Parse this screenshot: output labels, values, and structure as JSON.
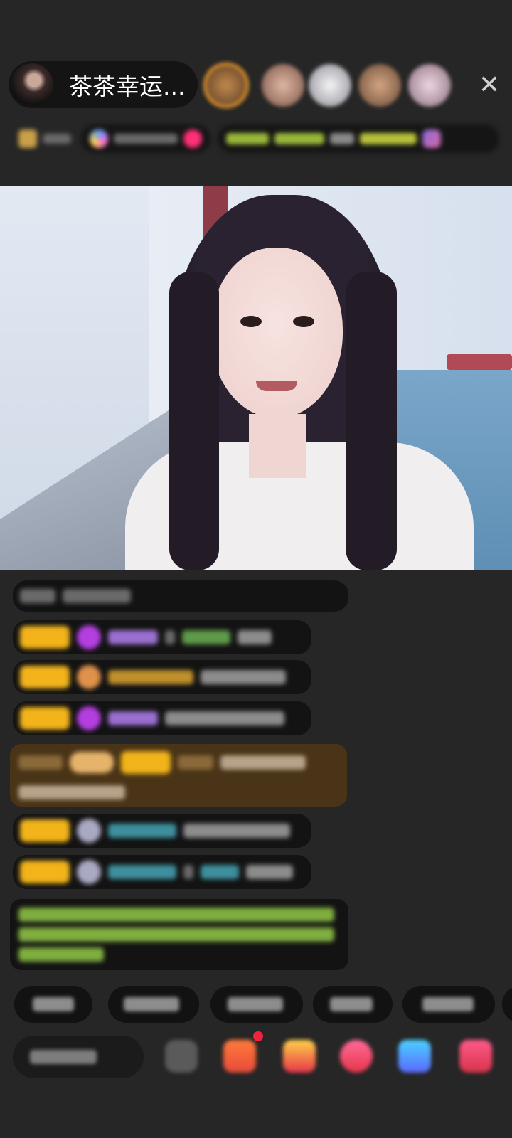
{
  "header": {
    "host_name": "茶茶幸运...",
    "close_symbol": "✕"
  },
  "viewers": [
    {
      "icon": "viewer-avatar-1",
      "color": "#a06b3e"
    },
    {
      "icon": "viewer-avatar-2",
      "color": "#c89b87"
    },
    {
      "icon": "viewer-avatar-3",
      "color": "#d8d8dc"
    },
    {
      "icon": "viewer-avatar-4",
      "color": "#b88a6b"
    },
    {
      "icon": "viewer-avatar-5",
      "color": "#d6b8c6"
    }
  ],
  "colors": {
    "background": "#262626",
    "badge_yellow": "#f2b41a",
    "gift_row_bg": "#4a3417",
    "close_icon": "#cfcfcf",
    "notification": "#f0233a"
  }
}
